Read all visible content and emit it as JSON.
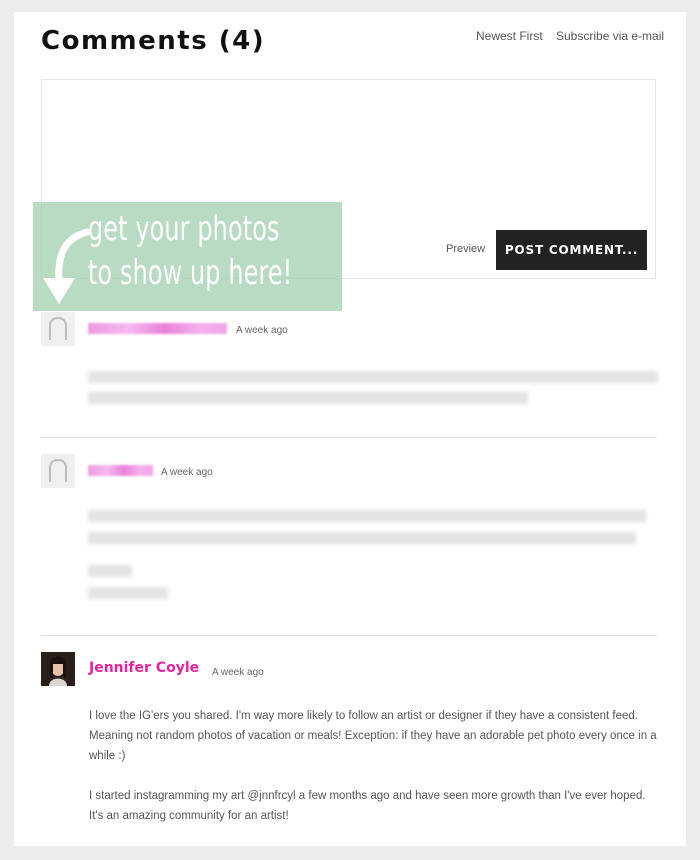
{
  "header": {
    "title": "Comments (4)",
    "sort_label": "Newest First",
    "subscribe_label": "Subscribe via e-mail"
  },
  "comment_form": {
    "preview_label": "Preview",
    "post_label": "POST COMMENT..."
  },
  "overlay": {
    "line1": "get your photos",
    "line2": "to show up here!",
    "color": "#aad2b6"
  },
  "comments": [
    {
      "author": "",
      "author_blurred": true,
      "time": "A week ago",
      "avatar": "default-avatar-icon"
    },
    {
      "author": "",
      "author_blurred": true,
      "time": "A week ago",
      "avatar": "default-avatar-icon"
    },
    {
      "author": "Jennifer Coyle",
      "author_blurred": false,
      "time": "A week ago",
      "avatar": "user-photo",
      "paragraphs": [
        "I love the IG'ers you shared. I'm way more likely to follow an artist or designer if they have a consistent feed. Meaning not random photos of vacation or meals! Exception: if they have an adorable pet photo every once in a while :)",
        "I started instagramming my art @jnnfrcyl a few months ago and have seen more growth than I've ever hoped. It's an amazing community for an artist!"
      ]
    }
  ],
  "colors": {
    "author_link": "#e4239f",
    "button_bg": "#222222",
    "page_bg": "#ececec"
  }
}
